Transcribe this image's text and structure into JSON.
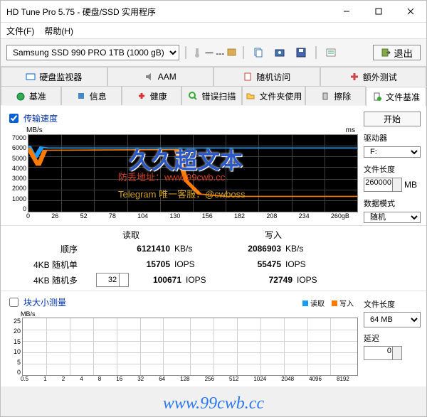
{
  "window": {
    "title": "HD Tune Pro 5.75 - 硬盘/SSD 实用程序"
  },
  "menu": {
    "file": "文件(F)",
    "help": "帮助(H)"
  },
  "toolbar": {
    "drive": "Samsung SSD 990 PRO 1TB (1000 gB)",
    "temp_dash": "一 ---",
    "exit": "退出"
  },
  "tabs_upper": [
    "硬盘监视器",
    "AAM",
    "随机访问",
    "额外测试"
  ],
  "tabs_lower": [
    "基准",
    "信息",
    "健康",
    "错误扫描",
    "文件夹使用",
    "擦除",
    "文件基准"
  ],
  "file_benchmark": {
    "checkbox_label": "传输速度",
    "start_btn": "开始",
    "drive_label": "驱动器",
    "drive_value": "F:",
    "filelen_label": "文件长度",
    "filelen_value": "260000",
    "filelen_unit": "MB",
    "datamode_label": "数据模式",
    "datamode_value": "随机"
  },
  "chart_data": {
    "type": "line",
    "title": "",
    "xlabel": "gB",
    "ylabel_left": "MB/s",
    "ylabel_right": "ms",
    "y_ticks": [
      "7000",
      "6000",
      "5000",
      "4000",
      "3000",
      "2000",
      "1000",
      "0"
    ],
    "x_ticks": [
      "0",
      "26",
      "52",
      "78",
      "104",
      "130",
      "156",
      "182",
      "208",
      "234",
      "260gB"
    ],
    "series": [
      {
        "name": "读取",
        "color": "#1a9cff",
        "values_approx": [
          6000,
          5800,
          5800,
          5800,
          5800,
          5800,
          5800,
          5800,
          5800,
          5800,
          5800
        ]
      },
      {
        "name": "写入",
        "color": "#ff7b00",
        "values_approx": [
          5800,
          5700,
          5700,
          5700,
          5700,
          2200,
          1600,
          1400,
          1400,
          1400,
          1400
        ]
      }
    ],
    "ylim": [
      0,
      7000
    ]
  },
  "results": {
    "header_read": "读取",
    "header_write": "写入",
    "rows": [
      {
        "label": "顺序",
        "read_val": "6121410",
        "read_unit": "KB/s",
        "write_val": "2086903",
        "write_unit": "KB/s"
      },
      {
        "label": "4KB 随机单",
        "read_val": "15705",
        "read_unit": "IOPS",
        "write_val": "55475",
        "write_unit": "IOPS"
      },
      {
        "label": "4KB 随机多",
        "read_val": "100671",
        "read_unit": "IOPS",
        "write_val": "72749",
        "write_unit": "IOPS",
        "spinner": "32"
      }
    ]
  },
  "block_size": {
    "checkbox_label": "块大小测量",
    "legend_read": "读取",
    "legend_write": "写入",
    "y_unit": "MB/s",
    "y_ticks": [
      "25",
      "20",
      "15",
      "10",
      "5",
      "0"
    ],
    "x_ticks": [
      "0.5",
      "1",
      "2",
      "4",
      "8",
      "16",
      "32",
      "64",
      "128",
      "256",
      "512",
      "1024",
      "2048",
      "4096",
      "8192"
    ],
    "filelen_label": "文件长度",
    "filelen_value": "64 MB",
    "delay_label": "延迟",
    "delay_value": "0"
  },
  "watermarks": {
    "big": "久久超文本",
    "line2": "防丢地址：www.99cwb.cc",
    "line3": "Telegram 唯一客服：@cwboss",
    "footer": "www.99cwb.cc"
  }
}
